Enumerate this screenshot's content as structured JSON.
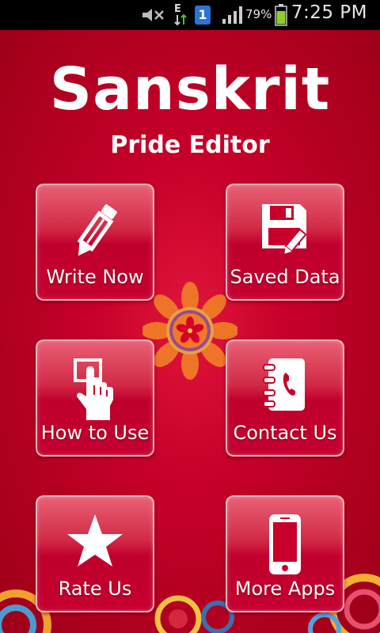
{
  "status_bar": {
    "time": "7:25 PM",
    "battery_percent": "79%",
    "sim_badge": "1",
    "network_letter": "E",
    "icons": [
      "no-sound-icon",
      "data-e-icon",
      "sim-1-icon",
      "signal-icon",
      "battery-icon"
    ]
  },
  "app": {
    "title": "Sanskrit",
    "subtitle": "Pride Editor",
    "tiles": [
      {
        "label": "Write Now",
        "icon": "pencil-icon"
      },
      {
        "label": "Saved Data",
        "icon": "floppy-disk-icon"
      },
      {
        "label": "How to Use",
        "icon": "tap-hand-icon"
      },
      {
        "label": "Contact Us",
        "icon": "address-book-icon"
      },
      {
        "label": "Rate Us",
        "icon": "star-icon"
      },
      {
        "label": "More Apps",
        "icon": "smartphone-icon"
      }
    ]
  },
  "colors": {
    "background": "#c8002a",
    "tile": "#d22a46",
    "text": "#ffffff"
  }
}
